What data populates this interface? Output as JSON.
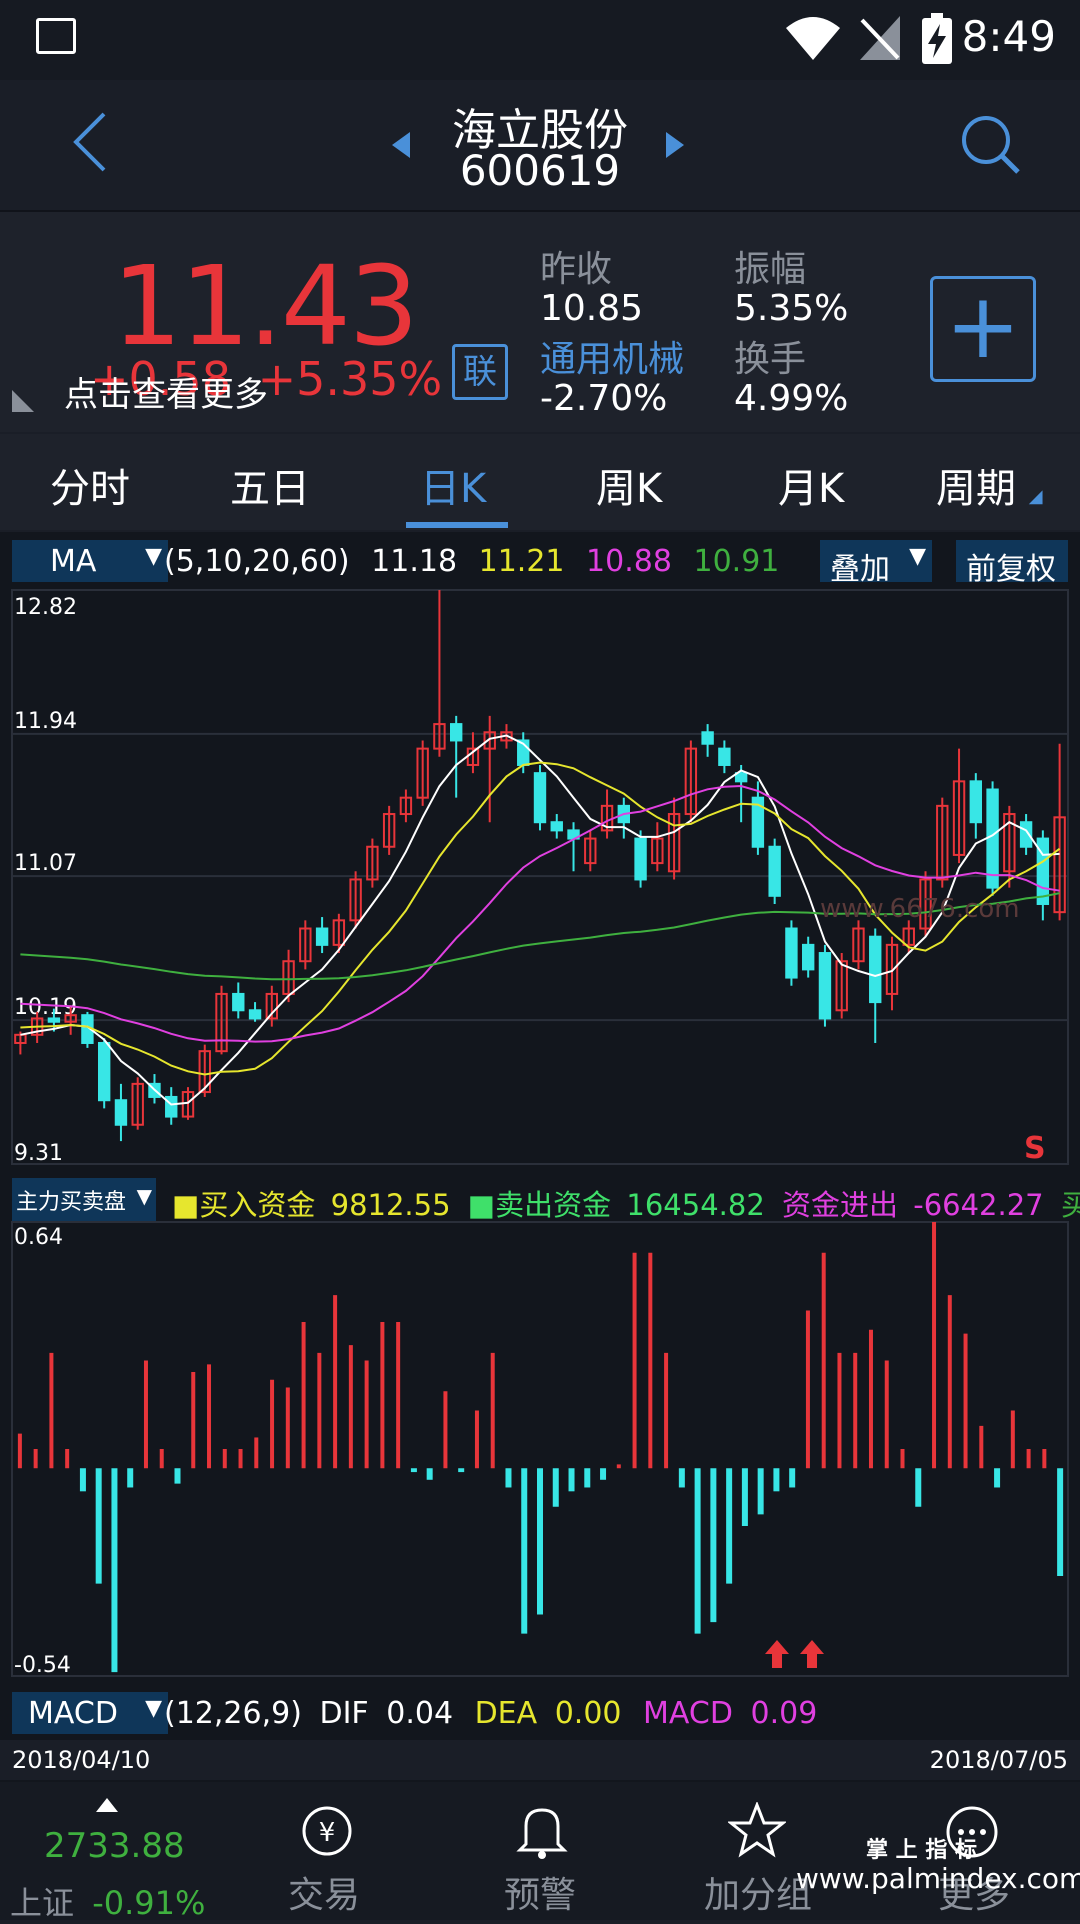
{
  "status_bar": {
    "time": "8:49"
  },
  "header": {
    "stock_name": "海立股份",
    "stock_code": "600619"
  },
  "quote": {
    "price": "11.43",
    "change": "+0.58",
    "change_pct": "+5.35%",
    "hint": "点击查看更多",
    "link_badge": "联",
    "prev_close_label": "昨收",
    "prev_close": "10.85",
    "amplitude_label": "振幅",
    "amplitude": "5.35%",
    "sector_label": "通用机械",
    "sector_change": "-2.70%",
    "turnover_label": "换手",
    "turnover": "4.99%"
  },
  "tabs": [
    "分时",
    "五日",
    "日K",
    "周K",
    "月K",
    "周期"
  ],
  "active_tab": "日K",
  "ma_bar": {
    "indicator": "MA",
    "params": "(5,10,20,60)",
    "ma5": "11.18",
    "ma10": "11.21",
    "ma20": "10.88",
    "ma60": "10.91",
    "overlay_label": "叠加",
    "adjust_label": "前复权"
  },
  "kline_axis": {
    "max": "12.82",
    "l2": "11.94",
    "l3": "11.07",
    "l4": "10.19",
    "min": "9.31",
    "signal": "S"
  },
  "flow_bar": {
    "indicator": "主力买卖盘",
    "buy_label": "■买入资金",
    "buy_value": "9812.55",
    "sell_label": "■卖出资金",
    "sell_value": "16454.82",
    "net_label": "资金进出",
    "net_value": "-6642.27",
    "extra": "买卖"
  },
  "flow_axis": {
    "max": "0.64",
    "min": "-0.54"
  },
  "macd_bar": {
    "indicator": "MACD",
    "params": "(12,26,9)",
    "dif_label": "DIF",
    "dif": "0.04",
    "dea_label": "DEA",
    "dea": "0.00",
    "macd_label": "MACD",
    "macd": "0.09"
  },
  "dates": {
    "start": "2018/04/10",
    "end": "2018/07/05"
  },
  "watermark": "www.6676.com",
  "bottom_nav": {
    "index_value": "2733.88",
    "index_name": "上证",
    "index_change": "-0.91%",
    "items": [
      "交易",
      "预警",
      "加分组",
      "更多"
    ],
    "brand_top": "掌 上 指 标",
    "brand_url": "www.palmindex.com"
  },
  "colors": {
    "up": "#e8353a",
    "down": "#38e6e6",
    "accent": "#4a90d9",
    "ma5": "#ffffff",
    "ma10": "#e6e62e",
    "ma20": "#e040e0",
    "ma60": "#3fb03f"
  },
  "chart_data": {
    "type": "candlestick",
    "price_range": [
      9.31,
      12.82
    ],
    "candles": [
      [
        10.05,
        10.1,
        9.98,
        10.12
      ],
      [
        10.1,
        10.2,
        10.05,
        10.24
      ],
      [
        10.2,
        10.18,
        10.12,
        10.26
      ],
      [
        10.18,
        10.22,
        10.1,
        10.28
      ],
      [
        10.22,
        10.05,
        10.02,
        10.24
      ],
      [
        10.05,
        9.7,
        9.65,
        10.08
      ],
      [
        9.7,
        9.55,
        9.45,
        9.8
      ],
      [
        9.55,
        9.8,
        9.52,
        9.84
      ],
      [
        9.8,
        9.72,
        9.68,
        9.86
      ],
      [
        9.72,
        9.6,
        9.55,
        9.78
      ],
      [
        9.6,
        9.75,
        9.58,
        9.78
      ],
      [
        9.75,
        10.0,
        9.72,
        10.04
      ],
      [
        10.0,
        10.35,
        9.98,
        10.4
      ],
      [
        10.35,
        10.25,
        10.2,
        10.42
      ],
      [
        10.25,
        10.2,
        10.18,
        10.3
      ],
      [
        10.2,
        10.35,
        10.15,
        10.4
      ],
      [
        10.35,
        10.55,
        10.3,
        10.62
      ],
      [
        10.55,
        10.75,
        10.5,
        10.8
      ],
      [
        10.75,
        10.65,
        10.6,
        10.82
      ],
      [
        10.65,
        10.8,
        10.6,
        10.84
      ],
      [
        10.8,
        11.05,
        10.75,
        11.1
      ],
      [
        11.05,
        11.25,
        11.0,
        11.3
      ],
      [
        11.25,
        11.45,
        11.2,
        11.5
      ],
      [
        11.45,
        11.55,
        11.4,
        11.6
      ],
      [
        11.55,
        11.85,
        11.5,
        11.9
      ],
      [
        11.85,
        12.0,
        11.8,
        12.82
      ],
      [
        12.0,
        11.9,
        11.55,
        12.05
      ],
      [
        11.75,
        11.85,
        11.7,
        11.95
      ],
      [
        11.85,
        11.95,
        11.4,
        12.05
      ],
      [
        11.9,
        11.95,
        11.85,
        12.0
      ],
      [
        11.9,
        11.75,
        11.7,
        11.95
      ],
      [
        11.7,
        11.4,
        11.35,
        11.75
      ],
      [
        11.4,
        11.35,
        11.3,
        11.45
      ],
      [
        11.35,
        11.3,
        11.1,
        11.4
      ],
      [
        11.15,
        11.3,
        11.1,
        11.35
      ],
      [
        11.35,
        11.5,
        11.3,
        11.6
      ],
      [
        11.5,
        11.4,
        11.3,
        11.55
      ],
      [
        11.3,
        11.05,
        11.0,
        11.35
      ],
      [
        11.15,
        11.3,
        11.1,
        11.4
      ],
      [
        11.1,
        11.45,
        11.05,
        11.55
      ],
      [
        11.45,
        11.85,
        11.4,
        11.9
      ],
      [
        11.95,
        11.88,
        11.8,
        12.0
      ],
      [
        11.85,
        11.75,
        11.7,
        11.9
      ],
      [
        11.7,
        11.65,
        11.4,
        11.75
      ],
      [
        11.55,
        11.25,
        11.2,
        11.65
      ],
      [
        11.25,
        10.95,
        10.9,
        11.3
      ],
      [
        10.75,
        10.45,
        10.4,
        10.8
      ],
      [
        10.65,
        10.5,
        10.45,
        10.7
      ],
      [
        10.6,
        10.2,
        10.15,
        10.65
      ],
      [
        10.25,
        10.55,
        10.2,
        10.6
      ],
      [
        10.55,
        10.75,
        10.5,
        10.8
      ],
      [
        10.7,
        10.3,
        10.05,
        10.75
      ],
      [
        10.35,
        10.65,
        10.25,
        10.7
      ],
      [
        10.65,
        10.75,
        10.6,
        10.8
      ],
      [
        10.75,
        11.05,
        10.7,
        11.1
      ],
      [
        11.05,
        11.5,
        11.0,
        11.55
      ],
      [
        11.2,
        11.65,
        11.15,
        11.85
      ],
      [
        11.65,
        11.4,
        11.3,
        11.7
      ],
      [
        11.6,
        11.0,
        10.95,
        11.65
      ],
      [
        11.1,
        11.45,
        11.0,
        11.5
      ],
      [
        11.4,
        11.25,
        11.2,
        11.45
      ],
      [
        11.3,
        10.9,
        10.8,
        11.35
      ],
      [
        10.85,
        11.43,
        10.8,
        11.88
      ]
    ],
    "flow_range": [
      -0.54,
      0.64
    ],
    "flow": [
      0.09,
      0.05,
      0.3,
      0.05,
      -0.06,
      -0.3,
      -0.53,
      -0.05,
      0.28,
      0.05,
      -0.04,
      0.25,
      0.27,
      0.05,
      0.05,
      0.08,
      0.23,
      0.21,
      0.38,
      0.3,
      0.45,
      0.32,
      0.28,
      0.38,
      0.38,
      -0.01,
      -0.03,
      0.2,
      -0.01,
      0.15,
      0.3,
      -0.05,
      -0.43,
      -0.38,
      -0.1,
      -0.06,
      -0.05,
      -0.03,
      0.01,
      0.56,
      0.56,
      0.3,
      -0.05,
      -0.43,
      -0.4,
      -0.3,
      -0.15,
      -0.12,
      -0.06,
      -0.05,
      0.41,
      0.56,
      0.3,
      0.3,
      0.36,
      0.28,
      0.05,
      -0.1,
      0.64,
      0.45,
      0.35,
      0.11,
      -0.05,
      0.15,
      0.05,
      0.05,
      -0.28
    ]
  }
}
